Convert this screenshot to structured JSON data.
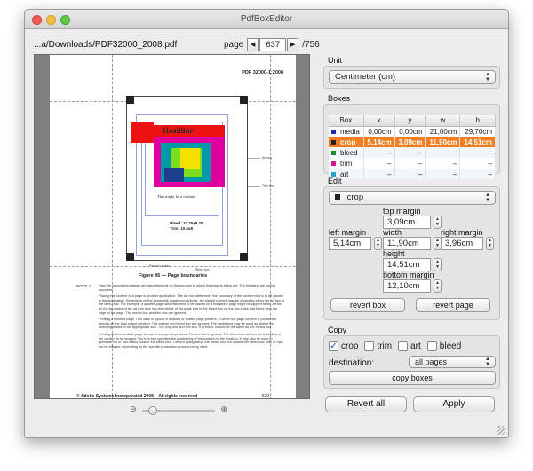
{
  "window": {
    "title": "PdfBoxEditor"
  },
  "file": {
    "path": "...a/Downloads/PDF32000_2008.pdf"
  },
  "page_nav": {
    "label": "page",
    "current": "637",
    "total": "/756",
    "prev_icon": "◀",
    "next_icon": "▶"
  },
  "document": {
    "header_right": "PDF 32000-1:2008",
    "headline": "Headline",
    "caption": "This might be a caption",
    "bleed_line1": "Bleed: 10.75x8.25",
    "bleed_line2": "Trim: 10.5x8",
    "annot_artbox": "Art box",
    "annot_trimbox": "Trim box",
    "annot_printer": "Printer's marks",
    "annot_bleedbox": "Bleed box",
    "figure_title": "Figure 86 — Page boundaries",
    "note_label": "NOTE 1",
    "paragraphs": [
      "How the various boundaries are used depends on the purpose to which the page is being put. The following are typical purposes:",
      "Placing the content of a page in another application. The art box determines the boundary of the content that is to be placed in the application. Depending on the applicable usage conventions, the placed content may be clipped to either the art box or the bleed box. For example, a quarter-page advertisement to be placed on a magazine page might be clipped to the art box on the two sides of the ad that face into the middle of the page and to the bleed box on the two sides that bleed over the edge of the page. The media box and trim box are ignored.",
      "Printing a finished page. This case is typical of desktop or shared page printers, in which the page content is positioned directly on the final output medium. The art box and bleed box are ignored. The media box may be used as advice for selecting media of the appropriate size. The crop box and trim box, if present, should be the same as the media box.",
      "Printing an intermediate page for use in a prepress process. The art box is ignored. The bleed box defines the boundary of the content to be imaged. The trim box specifies the positioning of the content on the medium; it may also be used to generate cut or fold marks outside the bleed box. Content falling within the media box but outside the bleed box may or may not be imaged, depending on the specific production process being used."
    ],
    "footer_left": "© Adobe Systems Incorporated 2008 – All rights reserved",
    "footer_right": "629"
  },
  "zoom": {
    "out_icon": "⊖",
    "in_icon": "⊕",
    "level": 0.1
  },
  "unit": {
    "section_label": "Unit",
    "selected": "Centimeter (cm)"
  },
  "boxes": {
    "section_label": "Boxes",
    "columns": [
      "Box",
      "x",
      "y",
      "w",
      "h"
    ],
    "rows": [
      {
        "name": "media",
        "color": "#1c2fa8",
        "x": "0,00cm",
        "y": "0,00cm",
        "w": "21,00cm",
        "h": "29,70cm",
        "selected": false
      },
      {
        "name": "crop",
        "color": "#222222",
        "x": "5,14cm",
        "y": "3,09cm",
        "w": "11,90cm",
        "h": "14,51cm",
        "selected": true
      },
      {
        "name": "bleed",
        "color": "#1a8a2a",
        "x": "–",
        "y": "–",
        "w": "–",
        "h": "–",
        "selected": false
      },
      {
        "name": "trim",
        "color": "#d1169c",
        "x": "–",
        "y": "–",
        "w": "–",
        "h": "–",
        "selected": false
      },
      {
        "name": "art",
        "color": "#22a3d6",
        "x": "–",
        "y": "–",
        "w": "–",
        "h": "–",
        "selected": false
      }
    ]
  },
  "edit": {
    "section_label": "Edit",
    "selected_box": "crop",
    "top_margin_label": "top margin",
    "top_margin": "3,09cm",
    "left_margin_label": "left margin",
    "left_margin": "5,14cm",
    "width_label": "width",
    "width": "11,90cm",
    "right_margin_label": "right margin",
    "right_margin": "3,96cm",
    "height_label": "height",
    "height": "14,51cm",
    "bottom_margin_label": "bottom margin",
    "bottom_margin": "12,10cm",
    "revert_box": "revert box",
    "revert_page": "revert page"
  },
  "copy": {
    "section_label": "Copy",
    "options": [
      {
        "label": "crop",
        "checked": true
      },
      {
        "label": "trim",
        "checked": false
      },
      {
        "label": "art",
        "checked": false
      },
      {
        "label": "bleed",
        "checked": false
      }
    ],
    "destination_label": "destination:",
    "destination": "all pages",
    "copy_button": "copy boxes"
  },
  "footer": {
    "revert_all": "Revert all",
    "apply": "Apply"
  }
}
